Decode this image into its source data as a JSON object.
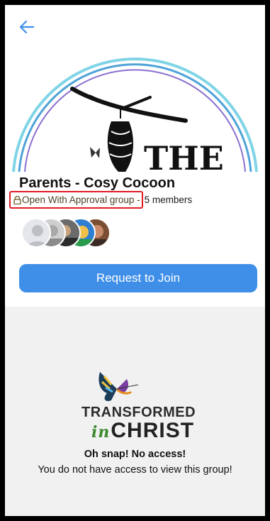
{
  "header": {
    "back_icon": "arrow-left-icon"
  },
  "banner": {
    "text": "THE",
    "image": "butterfly-chrysalis-on-branch"
  },
  "group": {
    "name": "Parents - Cosy Cocoon",
    "privacy_label": "Open With Approval group -",
    "members_label": "5 members",
    "lock_icon": "lock-icon",
    "member_avatars": [
      "default-avatar",
      "member-photo-1",
      "member-photo-2",
      "member-photo-3",
      "member-photo-4"
    ]
  },
  "actions": {
    "join_label": "Request to Join"
  },
  "no_access": {
    "logo_line1": "TRANSFORMED",
    "logo_script": "in",
    "logo_line2": "CHRIST",
    "title": "Oh snap! No access!",
    "message": "You do not have access to view this group!"
  },
  "colors": {
    "accent": "#3f8fe8",
    "highlight_border": "#e01b24",
    "lower_background": "#f1f1f1"
  }
}
